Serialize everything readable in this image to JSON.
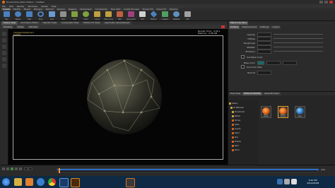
{
  "window": {
    "title": "Houdini Education Edition - Untitled"
  },
  "menu": [
    "File",
    "Edit",
    "Render",
    "Windows",
    "Assets",
    "Help"
  ],
  "shelf_tabs": [
    "Create",
    "Modify",
    "Model",
    "Polygon",
    "Deform",
    "Texture",
    "Rigging",
    "Characters",
    "Constraints",
    "Hair Utils",
    "Guide Process",
    "Terrain FX",
    "Cloud FX",
    "Volume"
  ],
  "shelf_tools": [
    "Box",
    "Sphere",
    "Tube",
    "Torus",
    "Grid",
    "Null",
    "Line",
    "Circle",
    "Curve",
    "Draw Curve",
    "Path",
    "Spray Paint",
    "Font",
    "Platonic",
    "L-System",
    "Metaball",
    "File"
  ],
  "viewport": {
    "tabs": [
      "Scene View",
      "Animation Editor",
      "Render View",
      "Composite View",
      "Motion FX View",
      "Geometry Spreadsheet"
    ],
    "toolbar": [
      "Shading",
      "Persp",
      "No Cam"
    ],
    "path_text": "/obj/geo1/platonic1",
    "camera_text": "persp1",
    "stats_labels": [
      "Render Time:",
      "Memory:"
    ],
    "stats_values": [
      "0.00 s",
      "2.08 GB"
    ]
  },
  "params": {
    "tabs": [
      "Mantra Surface"
    ],
    "subtabs": [
      "Surface",
      "Displacement",
      "Settings",
      "Layers"
    ],
    "rows": [
      "Opacity",
      "Diffuse",
      "Roughness",
      "Metallic",
      "Emission",
      "Base Color",
      "Normal"
    ],
    "checks": [
      "Use Base Color",
      "Use Color Map"
    ]
  },
  "material_palette": {
    "tabs": [
      "Tree View",
      "Material Palette",
      "Asset Browser"
    ],
    "tree": [
      "Gallery",
      "All Materials",
      "Procedurals",
      "Metals",
      "Stones",
      "Glass",
      "Liquids",
      "Fabric",
      "Skin",
      "Plastics",
      "Paint",
      "Wood"
    ],
    "thumbs": [
      "Basic Surface",
      "Mantra Surface",
      "Glass"
    ]
  },
  "timeline": {
    "frame": "1",
    "end_frame": "240"
  },
  "taskbar": {
    "time": "6:42 PM",
    "date": "2014/03/08"
  }
}
